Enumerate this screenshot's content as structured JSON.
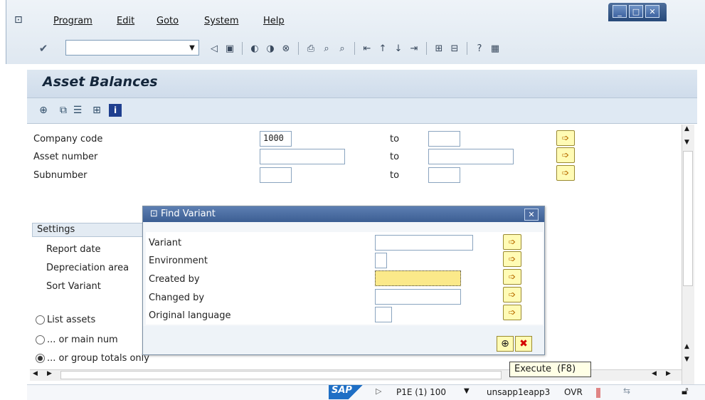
{
  "menu": {
    "items": [
      "Program",
      "Edit",
      "Goto",
      "System",
      "Help"
    ]
  },
  "page": {
    "title": "Asset Balances"
  },
  "form": {
    "company_code_label": "Company code",
    "company_code_value": "1000",
    "asset_number_label": "Asset number",
    "subnumber_label": "Subnumber",
    "to_label": "to",
    "settings_label": "Settings",
    "report_date_label": "Report date",
    "depreciation_area_label": "Depreciation area",
    "sort_variant_label": "Sort Variant",
    "radio_list_assets": "List assets",
    "radio_main_numbers": "... or main num",
    "radio_group_totals": "... or group totals only"
  },
  "dialog": {
    "title": "Find Variant",
    "variant_label": "Variant",
    "environment_label": "Environment",
    "created_by_label": "Created by",
    "changed_by_label": "Changed by",
    "original_language_label": "Original language"
  },
  "tooltip": {
    "text": "Execute  (F8)"
  },
  "statusbar": {
    "sap_logo": "SAP",
    "system": "P1E (1) 100",
    "server": "unsapp1eapp3",
    "mode": "OVR"
  },
  "icons": [
    "check-icon",
    "save-icon",
    "back-icon",
    "exit-icon",
    "cancel-icon",
    "print-icon",
    "find-icon",
    "find-next-icon",
    "first-page-icon",
    "prev-page-icon",
    "next-page-icon",
    "last-page-icon",
    "new-session-icon",
    "shortcut-icon",
    "help-icon",
    "layout-icon",
    "execute-icon",
    "get-variant-icon",
    "selection-options-icon",
    "dynamic-selection-icon",
    "info-icon",
    "multiple-selection-icon",
    "close-icon"
  ],
  "colors": {
    "accent": "#3c5e93",
    "multi_button_bg": "#fffbb5",
    "highlight_field": "#fbe98a"
  }
}
